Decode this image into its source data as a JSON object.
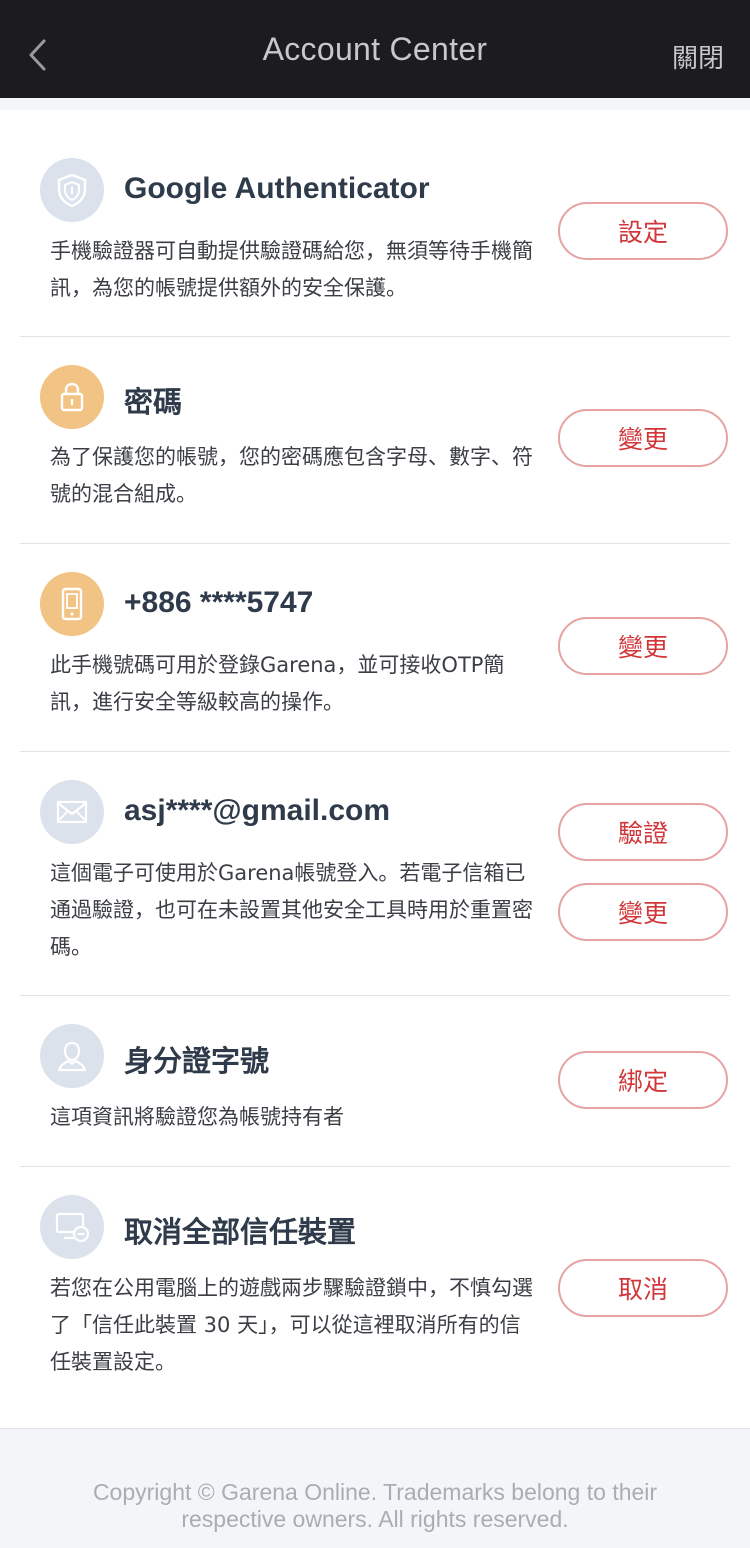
{
  "header": {
    "title": "Account Center",
    "close_label": "關閉"
  },
  "items": [
    {
      "name": "google-authenticator",
      "title": "Google Authenticator",
      "description": "手機驗證器可自動提供驗證碼給您，無須等待手機簡訊，為您的帳號提供額外的安全保護。",
      "icon": "shield-icon",
      "buttons": [
        "設定"
      ]
    },
    {
      "name": "password",
      "title": "密碼",
      "description": "為了保護您的帳號，您的密碼應包含字母、數字、符號的混合組成。",
      "icon": "lock-icon",
      "buttons": [
        "變更"
      ]
    },
    {
      "name": "phone",
      "title": "+886 ****5747",
      "description": "此手機號碼可用於登錄Garena，並可接收OTP簡訊，進行安全等級較高的操作。",
      "icon": "phone-icon",
      "buttons": [
        "變更"
      ]
    },
    {
      "name": "email",
      "title": "asj****@gmail.com",
      "description": "這個電子可使用於Garena帳號登入。若電子信箱已通過驗證，也可在未設置其他安全工具時用於重置密碼。",
      "icon": "mail-icon",
      "buttons": [
        "驗證",
        "變更"
      ]
    },
    {
      "name": "id-number",
      "title": "身分證字號",
      "description": "這項資訊將驗證您為帳號持有者",
      "icon": "user-icon",
      "buttons": [
        "綁定"
      ]
    },
    {
      "name": "trusted-devices",
      "title": "取消全部信任裝置",
      "description": "若您在公用電腦上的遊戲兩步驟驗證鎖中，不慎勾選了「信任此裝置 30 天」，可以從這裡取消所有的信任裝置設定。",
      "icon": "device-remove-icon",
      "buttons": [
        "取消"
      ]
    }
  ],
  "footer": {
    "copyright_line1": "Copyright © Garena Online. Trademarks belong to their",
    "copyright_line2": "respective owners. All rights reserved."
  },
  "colors": {
    "accent": "#d1373a",
    "nav_bg": "#1c1c1e",
    "icon_blue": "#dbe2ec",
    "icon_orange": "#f1c384"
  }
}
